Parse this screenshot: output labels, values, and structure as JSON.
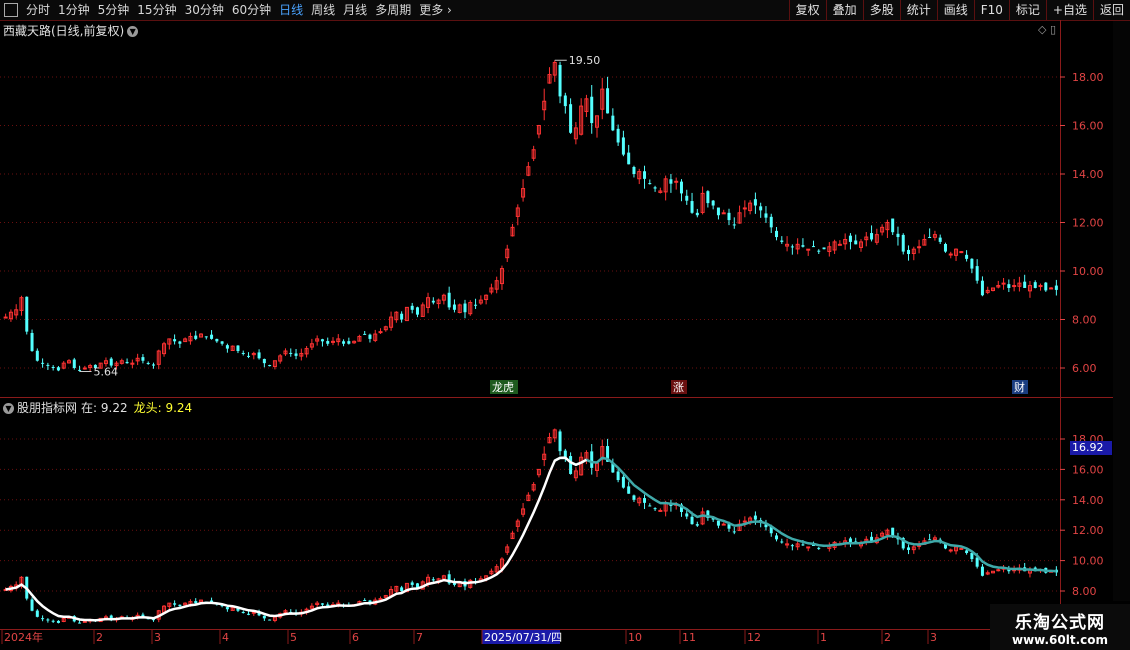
{
  "toolbar": {
    "left_items": [
      "分时",
      "1分钟",
      "5分钟",
      "15分钟",
      "30分钟",
      "60分钟",
      "日线",
      "周线",
      "月线",
      "多周期",
      "更多"
    ],
    "active_item": "日线",
    "right_buttons": [
      "复权",
      "叠加",
      "多股",
      "统计",
      "画线",
      "F10",
      "标记",
      "+自选",
      "返回"
    ]
  },
  "main_chart": {
    "title": "西藏天路(日线,前复权)",
    "high_label": "19.50",
    "low_label": "5.64",
    "event_tags": [
      "龙虎",
      "涨",
      "财"
    ]
  },
  "indicator": {
    "name": "股朋指标网",
    "value1_label": "在: 9.22",
    "value2_label": "龙头: 9.24",
    "price_tag": "16.92"
  },
  "colors": {
    "up": "#ff3232",
    "down": "#54ffff",
    "grid": "#6a0f0f",
    "axis_text": "#e04444",
    "line_white": "#ffffff",
    "line_teal": "#3fa9a9"
  },
  "chart_data": {
    "type": "candlestick",
    "price_axis_main": {
      "ylim": [
        5,
        20
      ],
      "ticks": [
        "6.00",
        "8.00",
        "10.00",
        "12.00",
        "14.00",
        "16.00",
        "18.00"
      ]
    },
    "price_axis_indicator": {
      "ylim": [
        8,
        19
      ],
      "ticks": [
        "8.00",
        "10.00",
        "12.00",
        "14.00",
        "16.00",
        "18.00"
      ]
    },
    "x_labels": [
      "2024年",
      "2",
      "3",
      "4",
      "5",
      "6",
      "7",
      "2025/07/31/四",
      "10",
      "11",
      "12",
      "1",
      "2",
      "3"
    ],
    "closes": [
      8.1,
      8.3,
      8.4,
      8.9,
      7.5,
      6.7,
      6.3,
      6.2,
      6.1,
      6.0,
      5.9,
      6.2,
      6.3,
      6.0,
      5.9,
      6.0,
      6.1,
      6.0,
      6.2,
      6.3,
      6.1,
      6.2,
      6.3,
      6.2,
      6.2,
      6.4,
      6.3,
      6.2,
      6.1,
      6.7,
      7.0,
      7.2,
      7.1,
      7.0,
      7.2,
      7.3,
      7.2,
      7.4,
      7.3,
      7.2,
      7.1,
      7.0,
      6.8,
      6.9,
      6.7,
      6.6,
      6.5,
      6.6,
      6.4,
      6.2,
      6.1,
      6.3,
      6.5,
      6.7,
      6.6,
      6.5,
      6.6,
      6.8,
      7.0,
      7.2,
      7.1,
      7.0,
      7.1,
      7.2,
      7.0,
      7.0,
      7.1,
      7.3,
      7.4,
      7.2,
      7.4,
      7.5,
      7.7,
      8.1,
      8.3,
      8.0,
      8.5,
      8.4,
      8.2,
      8.6,
      8.9,
      8.7,
      8.8,
      9.0,
      8.5,
      8.4,
      8.6,
      8.3,
      8.7,
      8.6,
      8.8,
      9.0,
      9.3,
      9.6,
      10.1,
      10.9,
      11.8,
      12.6,
      13.4,
      14.3,
      15.0,
      16.0,
      17.0,
      18.1,
      18.6,
      17.2,
      16.8,
      15.7,
      15.9,
      16.8,
      17.1,
      16.1,
      16.4,
      17.5,
      16.5,
      15.8,
      15.3,
      14.8,
      14.4,
      14.0,
      14.1,
      13.8,
      13.6,
      13.4,
      13.3,
      13.8,
      13.6,
      13.7,
      13.2,
      12.9,
      12.4,
      12.3,
      13.2,
      12.8,
      12.7,
      12.3,
      12.4,
      12.1,
      11.9,
      12.4,
      12.6,
      12.8,
      12.7,
      12.5,
      12.2,
      11.8,
      11.4,
      11.2,
      11.1,
      11.0,
      11.1,
      11.0,
      10.9,
      11.0,
      10.8,
      10.9,
      11.0,
      11.2,
      11.1,
      11.3,
      11.2,
      11.1,
      11.2,
      11.4,
      11.3,
      11.5,
      11.8,
      12.0,
      11.6,
      11.4,
      10.8,
      10.7,
      10.9,
      11.0,
      11.3,
      11.4,
      11.5,
      11.2,
      10.8,
      10.7,
      10.9,
      10.8,
      10.5,
      10.1,
      9.6,
      9.0,
      9.2,
      9.3,
      9.4,
      9.5,
      9.3,
      9.4,
      9.5,
      9.3,
      9.4,
      9.3,
      9.4,
      9.2,
      9.3,
      9.22
    ],
    "white_line_range": [
      0,
      110
    ],
    "teal_line_range": [
      104,
      211
    ]
  }
}
